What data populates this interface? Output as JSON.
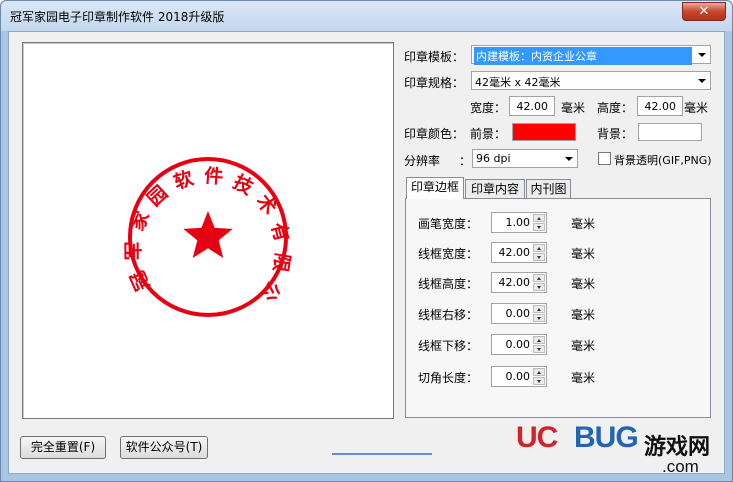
{
  "window": {
    "title": "冠军家园电子印章制作软件 2018升级版",
    "close_glyph": "✕"
  },
  "seal": {
    "text": "冠军家园软件技术有限公司",
    "color": "#e60012"
  },
  "form": {
    "template_label": "印章模板：",
    "template_value": "内建模板：内资企业公章",
    "spec_label": "印章规格：",
    "spec_value": "42毫米 x 42毫米",
    "width_label": "宽度：",
    "width_value": "42.00",
    "width_unit": "毫米",
    "height_label": "高度：",
    "height_value": "42.00",
    "height_unit": "毫米",
    "color_label": "印章颜色：",
    "foreground_label": "前景：",
    "foreground_color": "#ff0000",
    "background_label": "背景：",
    "background_color": "#ffffff",
    "resolution_label": "分辨率",
    "resolution_colon": "：",
    "resolution_value": "96 dpi",
    "transparent_label": "背景透明(GIF,PNG)"
  },
  "tabs": [
    {
      "label": "印章边框"
    },
    {
      "label": "印章内容"
    },
    {
      "label": "内刊图"
    }
  ],
  "border_fields": [
    {
      "label": "画笔宽度：",
      "value": "1.00",
      "unit": "毫米"
    },
    {
      "label": "线框宽度：",
      "value": "42.00",
      "unit": "毫米"
    },
    {
      "label": "线框高度：",
      "value": "42.00",
      "unit": "毫米"
    },
    {
      "label": "线框右移：",
      "value": "0.00",
      "unit": "毫米"
    },
    {
      "label": "线框下移：",
      "value": "0.00",
      "unit": "毫米"
    },
    {
      "label": "切角长度：",
      "value": "0.00",
      "unit": "毫米"
    }
  ],
  "buttons": {
    "reset": "完全重置(F)",
    "wechat": "软件公众号(T)"
  },
  "watermark": {
    "uc": "UC",
    "bug": "BUG",
    "cn": "游戏网",
    "com": ".com"
  }
}
